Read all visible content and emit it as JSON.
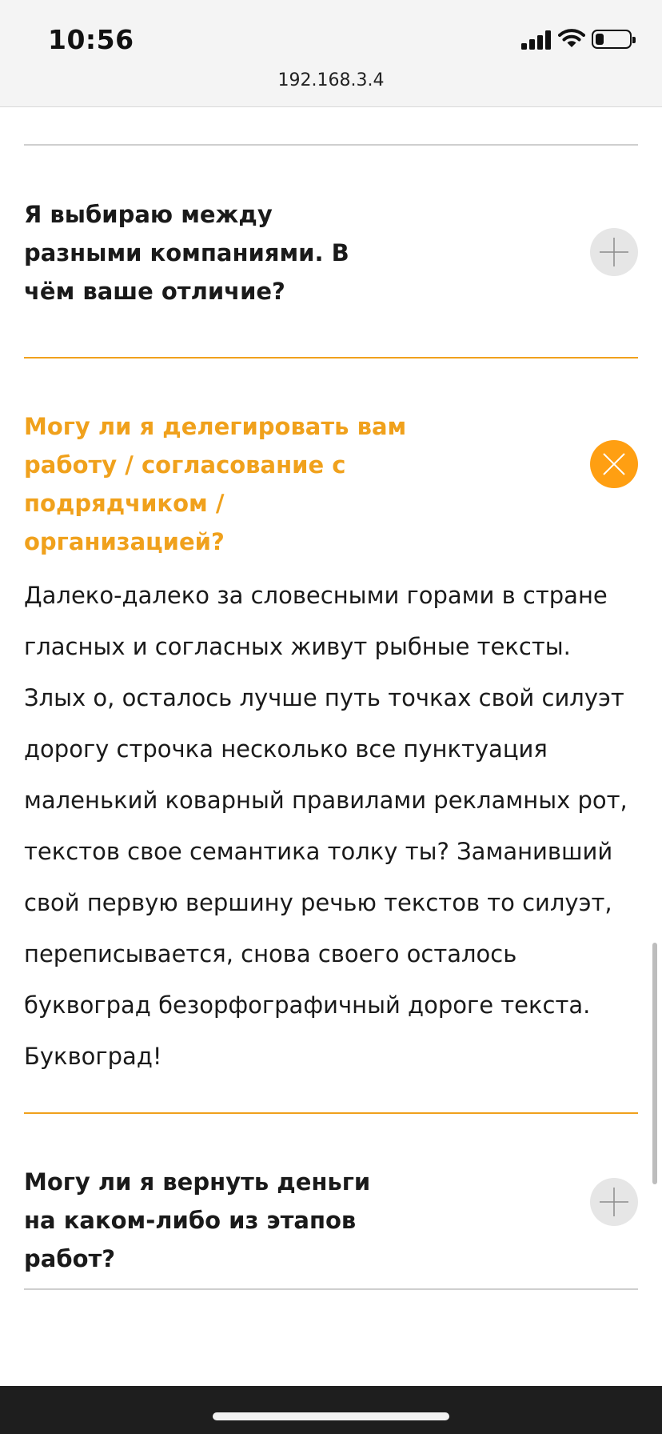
{
  "status_bar": {
    "time": "10:56",
    "signal_icon": "cellular-signal-icon",
    "wifi_icon": "wifi-icon",
    "battery_icon": "battery-icon",
    "battery_level": 0.25
  },
  "browser": {
    "url": "192.168.3.4"
  },
  "colors": {
    "accent": "#f0a11c",
    "accent_button": "#ff9f12",
    "text": "#1a1a1a",
    "toggle_closed": "#e6e6e6",
    "divider": "#cfcfcf"
  },
  "faq": {
    "items": [
      {
        "question": "Я выбираю между разными компаниями. В чём ваше отличие?",
        "expanded": false,
        "toggle_icon": "plus-icon"
      },
      {
        "question": "Могу ли я делегировать вам работу / согласование с подрядчиком / организацией?",
        "expanded": true,
        "toggle_icon": "close-icon",
        "answer": "Далеко-далеко за словесными горами в стране гласных и согласных живут рыбные тексты. Злых о, осталось лучше путь точках свой силуэт дорогу строчка несколько все пунктуация маленький коварный правилами рекламных рот, текстов свое семантика толку ты? Заманивший свой первую вершину речью текстов то силуэт, переписывается, снова своего осталось буквоград безорфографичный дороге текста. Буквоград!"
      },
      {
        "question": "Могу ли я вернуть деньги на каком-либо из этапов работ?",
        "expanded": false,
        "toggle_icon": "plus-icon"
      }
    ]
  }
}
